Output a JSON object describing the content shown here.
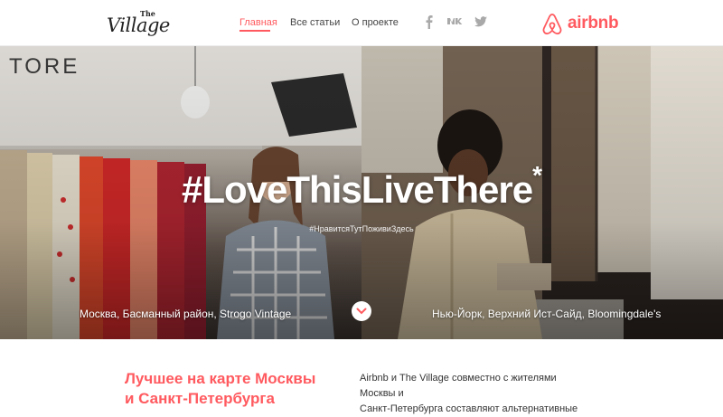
{
  "header": {
    "logo": {
      "the": "The",
      "village": "Village"
    },
    "nav": [
      {
        "label": "Главная",
        "active": true
      },
      {
        "label": "Все статьи",
        "active": false
      },
      {
        "label": "О проекте",
        "active": false
      }
    ],
    "social": [
      "facebook-icon",
      "vk-icon",
      "twitter-icon"
    ],
    "partner": {
      "name": "airbnb",
      "color": "#ff5a5f"
    }
  },
  "hero": {
    "hashtag": "#LoveThisLiveThere",
    "hashtag_mark": "*",
    "sub_hashtag": "#НравитсяТутПоживиЗдесь",
    "left_caption": "Москва, Басманный район, Strogo Vintage",
    "right_caption": "Нью-Йорк, Верхний Ист-Сайд, Bloomingdale's",
    "scroll_icon": "chevron-down-icon"
  },
  "intro": {
    "headline_line1": "Лучшее на карте Москвы",
    "headline_line2": "и Санкт-Петербурга",
    "text_line1": "Airbnb и The Village совместно с жителями Москвы и",
    "text_line2": "Санкт-Петербурга составляют альтернативные"
  },
  "colors": {
    "accent": "#ff5a5f",
    "text": "#333333",
    "social": "#a9a9a9"
  }
}
